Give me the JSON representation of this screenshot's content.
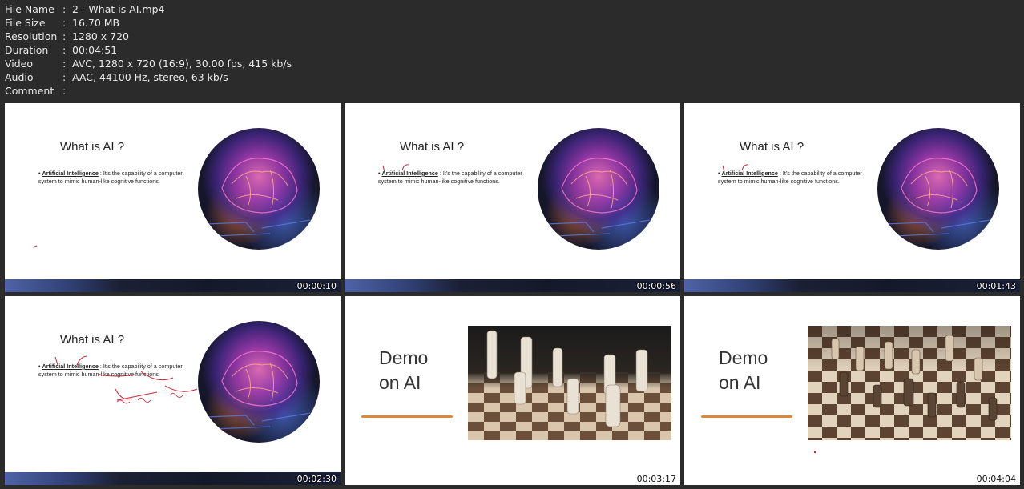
{
  "meta": [
    {
      "key": "File Name",
      "value": "2 - What is AI.mp4"
    },
    {
      "key": "File Size",
      "value": "16.70 MB"
    },
    {
      "key": "Resolution",
      "value": "1280 x 720"
    },
    {
      "key": "Duration",
      "value": "00:04:51"
    },
    {
      "key": "Video",
      "value": "AVC, 1280 x 720 (16:9), 30.00 fps, 415 kb/s"
    },
    {
      "key": "Audio",
      "value": "AAC, 44100 Hz, stereo, 63 kb/s"
    },
    {
      "key": "Comment",
      "value": ""
    }
  ],
  "separator": ":",
  "slide_ai": {
    "title": "What is AI ?",
    "term": "Artificial Intelligence",
    "definition": " : It’s the capability of a computer system to mimic human-like cognitive functions.",
    "bullet": "•"
  },
  "slide_demo": {
    "line1": "Demo",
    "line2": "on AI"
  },
  "thumbnails": [
    {
      "time": "00:00:10",
      "type": "ai"
    },
    {
      "time": "00:00:56",
      "type": "ai"
    },
    {
      "time": "00:01:43",
      "type": "ai"
    },
    {
      "time": "00:02:30",
      "type": "ai"
    },
    {
      "time": "00:03:17",
      "type": "demo"
    },
    {
      "time": "00:04:04",
      "type": "demo"
    }
  ],
  "colors": {
    "background": "#2b2b2b",
    "accent_underline": "#d88a3a",
    "annotation_ink": "#c0283a"
  }
}
